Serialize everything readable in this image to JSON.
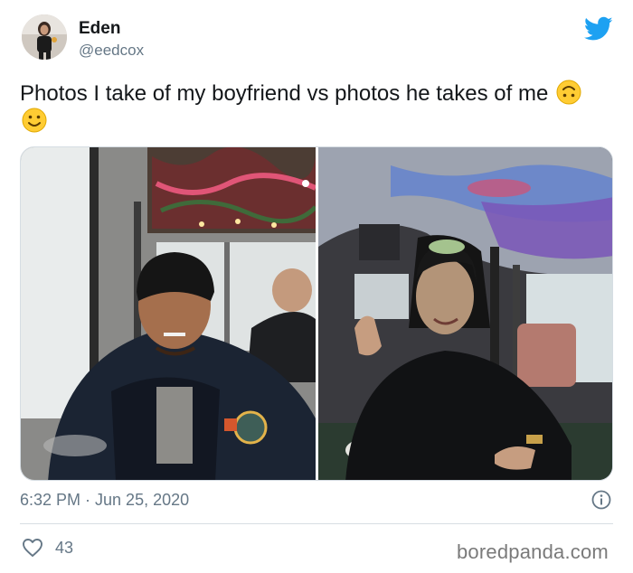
{
  "user": {
    "name": "Eden",
    "handle": "@eedcox"
  },
  "tweet": {
    "text": "Photos I take of my boyfriend vs photos he takes of me",
    "emojis": [
      "upside-down-face-emoji",
      "slightly-smiling-face-emoji"
    ],
    "timestamp": "6:32 PM · Jun 25, 2020",
    "likes": "43"
  },
  "media": {
    "left_photo": "boyfriend-photo",
    "right_photo": "girlfriend-photo"
  },
  "icons": {
    "brand": "twitter-bird-icon",
    "info": "info-icon",
    "like": "heart-icon"
  },
  "colors": {
    "twitter_blue": "#1da1f2",
    "secondary_text": "#657786"
  },
  "watermark": "boredpanda.com"
}
